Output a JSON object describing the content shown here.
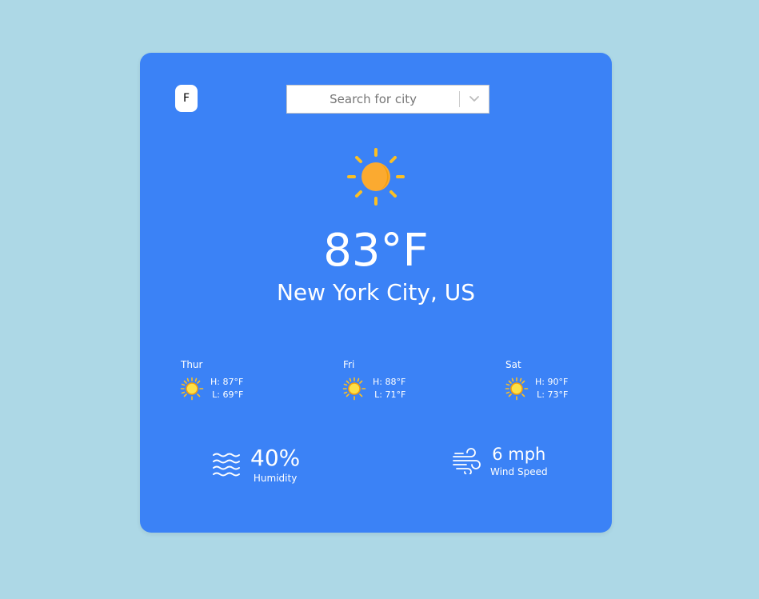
{
  "unit_toggle": {
    "label": "F"
  },
  "search": {
    "placeholder": "Search for city"
  },
  "current": {
    "icon": "sun-icon",
    "temperature": "83°F",
    "location": "New York City, US"
  },
  "forecast": [
    {
      "day": "Thur",
      "icon": "sun-icon",
      "high": "H: 87°F",
      "low": "L: 69°F"
    },
    {
      "day": "Fri",
      "icon": "sun-icon",
      "high": "H: 88°F",
      "low": "L: 71°F"
    },
    {
      "day": "Sat",
      "icon": "sun-icon",
      "high": "H: 90°F",
      "low": "L: 73°F"
    }
  ],
  "humidity": {
    "icon": "humidity-waves-icon",
    "value": "40%",
    "label": "Humidity"
  },
  "wind": {
    "icon": "wind-icon",
    "value": "6 mph",
    "label": "Wind Speed"
  },
  "colors": {
    "page_background": "#add8e6",
    "card_background": "#3b82f6",
    "sun_rays": "#fbbf24",
    "sun_body": "#f59e0b"
  }
}
